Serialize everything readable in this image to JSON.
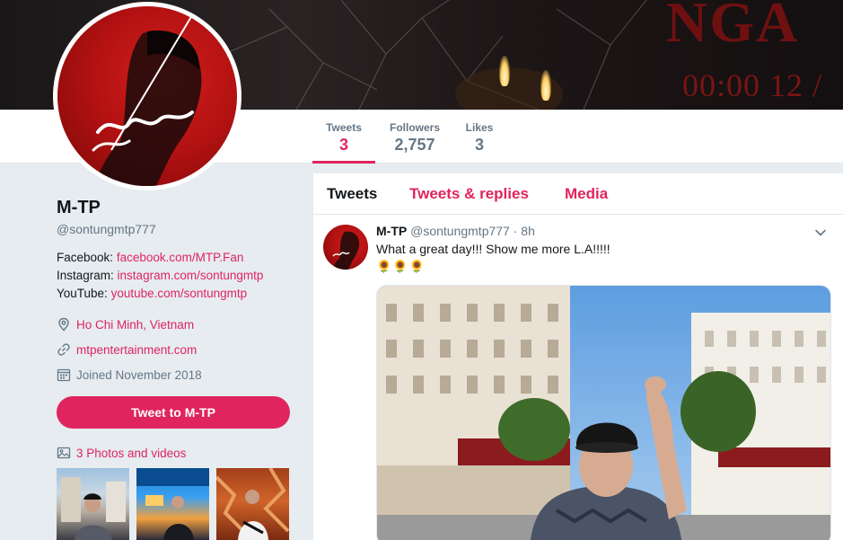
{
  "banner": {
    "title_text": "NGA",
    "countdown_text": "00:00 12 /"
  },
  "nav": {
    "stats": [
      {
        "label": "Tweets",
        "value": "3"
      },
      {
        "label": "Followers",
        "value": "2,757"
      },
      {
        "label": "Likes",
        "value": "3"
      }
    ]
  },
  "profile": {
    "name": "M-TP",
    "handle": "@sontungmtp777",
    "bio": [
      {
        "label": "Facebook:",
        "link": "facebook.com/MTP.Fan"
      },
      {
        "label": "Instagram:",
        "link": "instagram.com/sontungmtp"
      },
      {
        "label": "YouTube:",
        "link": "youtube.com/sontungmtp"
      }
    ],
    "location": "Ho Chi Minh, Vietnam",
    "website": "mtpentertainment.com",
    "joined": "Joined November 2018",
    "tweet_to_label": "Tweet to M-TP",
    "photos_label": "3 Photos and videos"
  },
  "timeline": {
    "tabs": [
      "Tweets",
      "Tweets & replies",
      "Media"
    ],
    "tweet": {
      "name": "M-TP",
      "handle": "@sontungmtp777",
      "separator": " · ",
      "time": "8h",
      "text": "What a great day!!! Show me more L.A!!!!!",
      "emoji": "🌻🌻🌻"
    }
  },
  "colors": {
    "accent": "#e0245e",
    "background": "#e6ecf0",
    "muted": "#657786"
  }
}
